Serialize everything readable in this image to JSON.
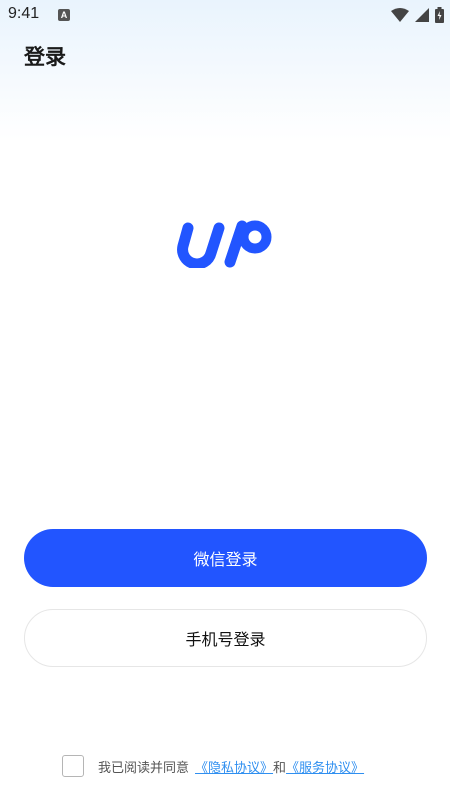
{
  "status_bar": {
    "time": "9:41",
    "notification_icon_letter": "A",
    "icons": [
      "wifi-icon",
      "signal-icon",
      "battery-icon"
    ]
  },
  "header": {
    "title": "登录"
  },
  "logo": {
    "icon": "up-logo-icon",
    "color": "#2255ff"
  },
  "buttons": {
    "wechat_login": "微信登录",
    "phone_login": "手机号登录"
  },
  "agreement": {
    "checked": false,
    "prefix": "我已阅读并同意",
    "privacy_link": "《隐私协议》",
    "connector": "和",
    "service_link": "《服务协议》"
  },
  "colors": {
    "primary": "#2255ff",
    "link": "#2f8ff0",
    "header_gradient_top": "#e9f4fd"
  }
}
